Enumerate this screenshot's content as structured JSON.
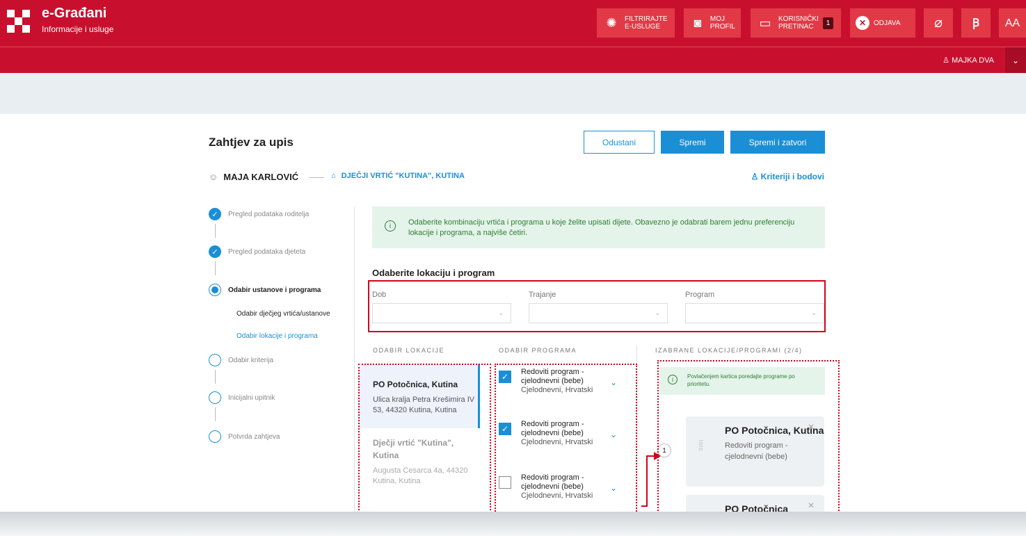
{
  "header": {
    "brand_title": "e-Građani",
    "brand_subtitle": "Informacije i usluge",
    "buttons": [
      {
        "label1": "FILTRIRAJTE",
        "label2": "E-USLUGE",
        "icon": "globe-filter-icon"
      },
      {
        "label1": "MOJ",
        "label2": "PROFIL",
        "icon": "profile-icon"
      },
      {
        "label1": "KORISNIČKI",
        "label2": "PRETINAC",
        "icon": "inbox-icon",
        "badge": "1"
      },
      {
        "label1": "ODJAVA",
        "label2": "",
        "icon": "close-circle-icon"
      }
    ],
    "user_name": "MAJKA DVA",
    "font_toggle": "AA"
  },
  "page": {
    "title": "Zahtjev za upis",
    "buttons": {
      "cancel": "Odustani",
      "save": "Spremi",
      "save_close": "Spremi i zatvori"
    },
    "child_name": "MAJA KARLOVIĆ",
    "institution": "DJEČJI VRTIĆ \"KUTINA\", KUTINA",
    "criteria_link": "Kriteriji i bodovi"
  },
  "steps": [
    {
      "label": "Pregled podataka roditelja",
      "state": "done"
    },
    {
      "label": "Pregled podataka djeteta",
      "state": "done"
    },
    {
      "label": "Odabir ustanove i programa",
      "state": "active"
    },
    {
      "label": "Odabir kriterija",
      "state": "todo"
    },
    {
      "label": "Inicijalni upitnik",
      "state": "todo"
    },
    {
      "label": "Potvrda zahtjeva",
      "state": "todo"
    }
  ],
  "substeps": [
    "Odabir dječjeg vrtića/ustanove",
    "Odabir lokacije i programa"
  ],
  "info_text": "Odaberite kombinaciju vrtića i programa u koje želite upisati dijete. Obavezno je odabrati barem jednu preferenciju lokacije i programa, a najviše četiri.",
  "filter": {
    "heading": "Odaberite lokaciju i program",
    "labels": [
      "Dob",
      "Trajanje",
      "Program"
    ]
  },
  "columns": {
    "locations": "ODABIR LOKACIJE",
    "programs": "ODABIR PROGRAMA",
    "selected": "IZABRANE LOKACIJE/PROGRAMI (2/4)"
  },
  "locations": [
    {
      "name": "PO Potočnica, Kutina",
      "address": "Ulica kralja Petra Krešimira IV 53, 44320 Kutina, Kutina"
    },
    {
      "name": "Dječji vrtić \"Kutina\", Kutina",
      "address": "Augusta Cesarca 4a, 44320 Kutina, Kutina"
    }
  ],
  "programs": [
    {
      "title": "Redoviti program - cjelodnevni (bebe)",
      "sub": "Cjelodnevni, Hrvatski",
      "checked": true
    },
    {
      "title": "Redoviti program - cjelodnevni (bebe)",
      "sub": "Cjelodnevni, Hrvatski",
      "checked": true
    },
    {
      "title": "Redoviti program - cjelodnevni (bebe)",
      "sub": "Cjelodnevni, Hrvatski",
      "checked": false
    }
  ],
  "selected_info": "Povlačenjem kartica poredajte programe po prioritetu.",
  "selected_cards": [
    {
      "title": "PO Potočnica, Kutina",
      "sub": "Redoviti program - cjelodnevni (bebe)",
      "priority": "1"
    },
    {
      "title": "PO Potočnica",
      "sub": "",
      "priority": ""
    }
  ],
  "colors": {
    "brand_red": "#c8102e",
    "accent_blue": "#1a8fd6",
    "success_green": "#2e7d32",
    "annotation_red": "#d0021b"
  }
}
